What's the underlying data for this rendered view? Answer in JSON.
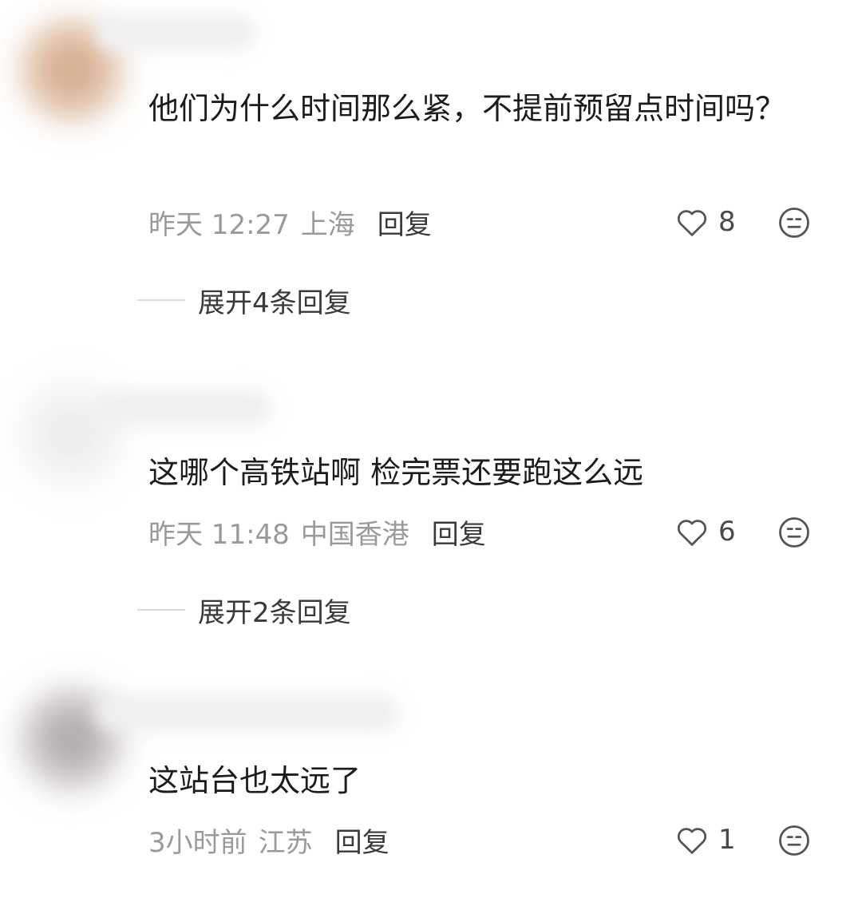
{
  "comments": [
    {
      "text": "他们为什么时间那么紧，不提前预留点时间吗？",
      "time": "昨天 12:27",
      "location": "上海",
      "reply_label": "回复",
      "likes": "8",
      "expand_label": "展开4条回复"
    },
    {
      "text": "这哪个高铁站啊 检完票还要跑这么远",
      "time": "昨天 11:48",
      "location": "中国香港",
      "reply_label": "回复",
      "likes": "6",
      "expand_label": "展开2条回复"
    },
    {
      "text": "这站台也太远了",
      "time": "3小时前",
      "location": "江苏",
      "reply_label": "回复",
      "likes": "1"
    }
  ],
  "icons": {
    "like": "heart-outline-icon",
    "react": "neutral-face-icon"
  },
  "colors": {
    "text": "#1c1c1c",
    "meta": "#9a9a9a",
    "icon": "#4a4a4a"
  }
}
